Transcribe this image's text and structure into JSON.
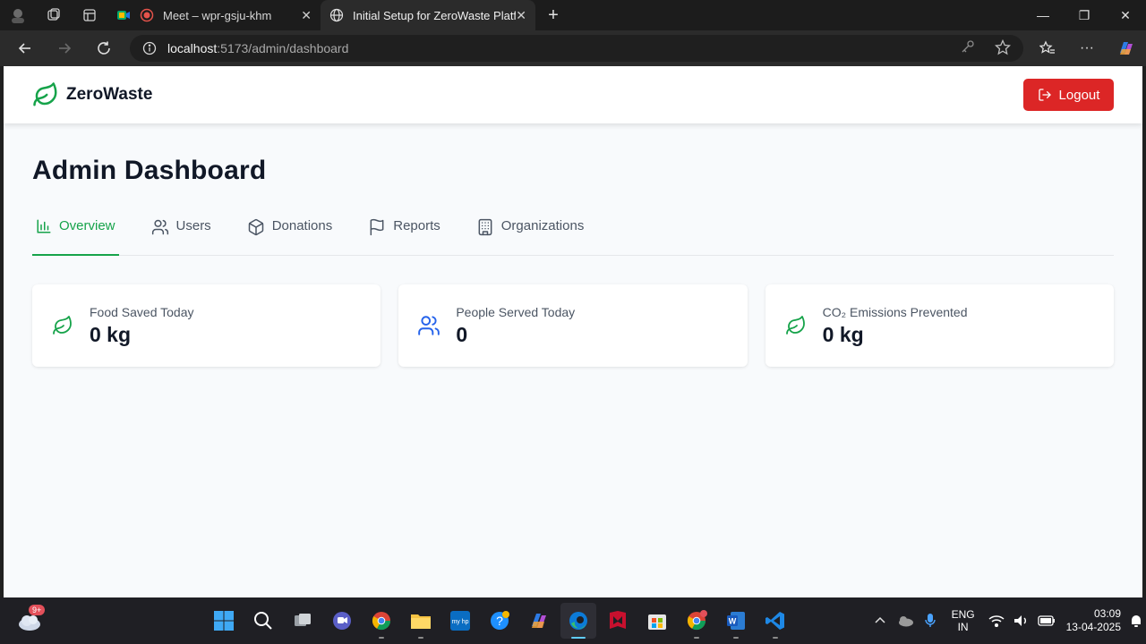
{
  "browser": {
    "tabs": [
      {
        "title": "Meet – wpr-gsju-khm",
        "active": false
      },
      {
        "title": "Initial Setup for ZeroWaste Platfor",
        "active": true
      }
    ],
    "url_host": "localhost",
    "url_path": ":5173/admin/dashboard"
  },
  "header": {
    "brand": "ZeroWaste",
    "logout_label": "Logout",
    "accent": "#16a34a",
    "danger": "#dc2626"
  },
  "page": {
    "title": "Admin Dashboard",
    "tabs": [
      {
        "label": "Overview",
        "icon": "bar-chart-icon",
        "active": true
      },
      {
        "label": "Users",
        "icon": "users-icon"
      },
      {
        "label": "Donations",
        "icon": "package-icon"
      },
      {
        "label": "Reports",
        "icon": "flag-icon"
      },
      {
        "label": "Organizations",
        "icon": "building-icon"
      }
    ],
    "stats": [
      {
        "label": "Food Saved Today",
        "value": "0 kg",
        "icon": "leaf-icon"
      },
      {
        "label": "People Served Today",
        "value": "0",
        "icon": "users-icon"
      },
      {
        "label": "CO₂ Emissions Prevented",
        "value": "0 kg",
        "icon": "leaf-icon"
      }
    ]
  },
  "taskbar": {
    "weather_badge": "9+",
    "lang_line1": "ENG",
    "lang_line2": "IN",
    "time": "03:09",
    "date": "13-04-2025"
  }
}
